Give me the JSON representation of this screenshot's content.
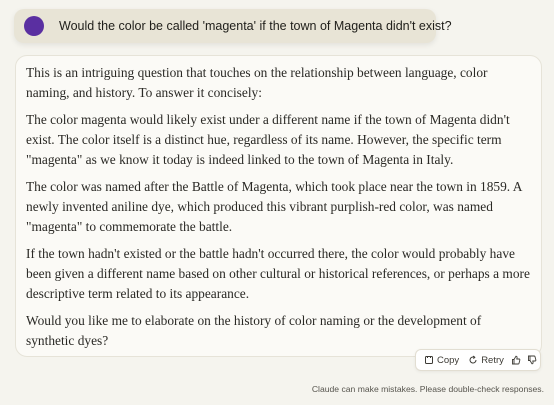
{
  "user_message": {
    "text": "Would the color be called 'magenta' if the town of Magenta didn't exist?",
    "avatar_color": "#5a2fa1"
  },
  "assistant_message": {
    "paragraphs": [
      "This is an intriguing question that touches on the relationship between language, color naming, and history. To answer it concisely:",
      "The color magenta would likely exist under a different name if the town of Magenta didn't exist. The color itself is a distinct hue, regardless of its name. However, the specific term \"magenta\" as we know it today is indeed linked to the town of Magenta in Italy.",
      "The color was named after the Battle of Magenta, which took place near the town in 1859. A newly invented aniline dye, which produced this vibrant purplish-red color, was named \"magenta\" to commemorate the battle.",
      "If the town hadn't existed or the battle hadn't occurred there, the color would probably have been given a different name based on other cultural or historical references, or perhaps a more descriptive term related to its appearance.",
      "Would you like me to elaborate on the history of color naming or the development of synthetic dyes?"
    ]
  },
  "actions": {
    "copy_label": "Copy",
    "retry_label": "Retry",
    "icons": [
      "copy-icon",
      "retry-icon",
      "thumbs-up-icon",
      "thumbs-down-icon"
    ]
  },
  "disclaimer": "Claude can make mistakes. Please double-check responses."
}
